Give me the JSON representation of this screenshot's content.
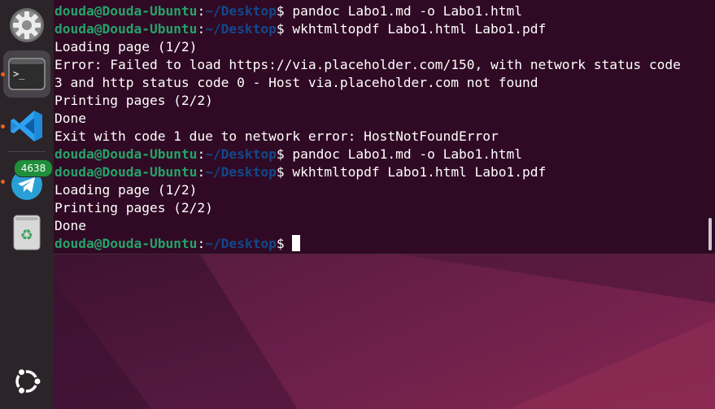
{
  "dock": {
    "badge_count": "4638",
    "items": [
      {
        "name": "settings",
        "icon": "gear-icon"
      },
      {
        "name": "terminal",
        "icon": "terminal-icon",
        "active": true
      },
      {
        "name": "vscode",
        "icon": "vscode-icon"
      },
      {
        "name": "telegram",
        "icon": "telegram-icon"
      },
      {
        "name": "trash",
        "icon": "trash-icon"
      },
      {
        "name": "show-apps",
        "icon": "ubuntu-icon"
      }
    ]
  },
  "terminal": {
    "prompt": {
      "user": "douda@Douda-Ubuntu",
      "colon": ":",
      "path": "~/Desktop",
      "dollar": "$"
    },
    "lines": [
      {
        "type": "prompt",
        "cmd": " pandoc Labo1.md -o Labo1.html"
      },
      {
        "type": "prompt",
        "cmd": " wkhtmltopdf Labo1.html Labo1.pdf"
      },
      {
        "type": "output",
        "text": "Loading page (1/2)"
      },
      {
        "type": "output",
        "text": "Error: Failed to load https://via.placeholder.com/150, with network status code"
      },
      {
        "type": "output",
        "text": "3 and http status code 0 - Host via.placeholder.com not found"
      },
      {
        "type": "output",
        "text": "Printing pages (2/2)"
      },
      {
        "type": "output",
        "text": "Done"
      },
      {
        "type": "output",
        "text": "Exit with code 1 due to network error: HostNotFoundError"
      },
      {
        "type": "prompt",
        "cmd": " pandoc Labo1.md -o Labo1.html"
      },
      {
        "type": "prompt",
        "cmd": " wkhtmltopdf Labo1.html Labo1.pdf"
      },
      {
        "type": "output",
        "text": "Loading page (1/2)"
      },
      {
        "type": "output",
        "text": "Printing pages (2/2)"
      },
      {
        "type": "output",
        "text": "Done"
      },
      {
        "type": "prompt",
        "cmd": " "
      }
    ]
  },
  "colors": {
    "terminal_bg": "#300a24",
    "prompt_user": "#26a269",
    "prompt_path": "#12488b",
    "dock_bg": "#2b2428",
    "badge_bg": "#1f8f3a"
  }
}
